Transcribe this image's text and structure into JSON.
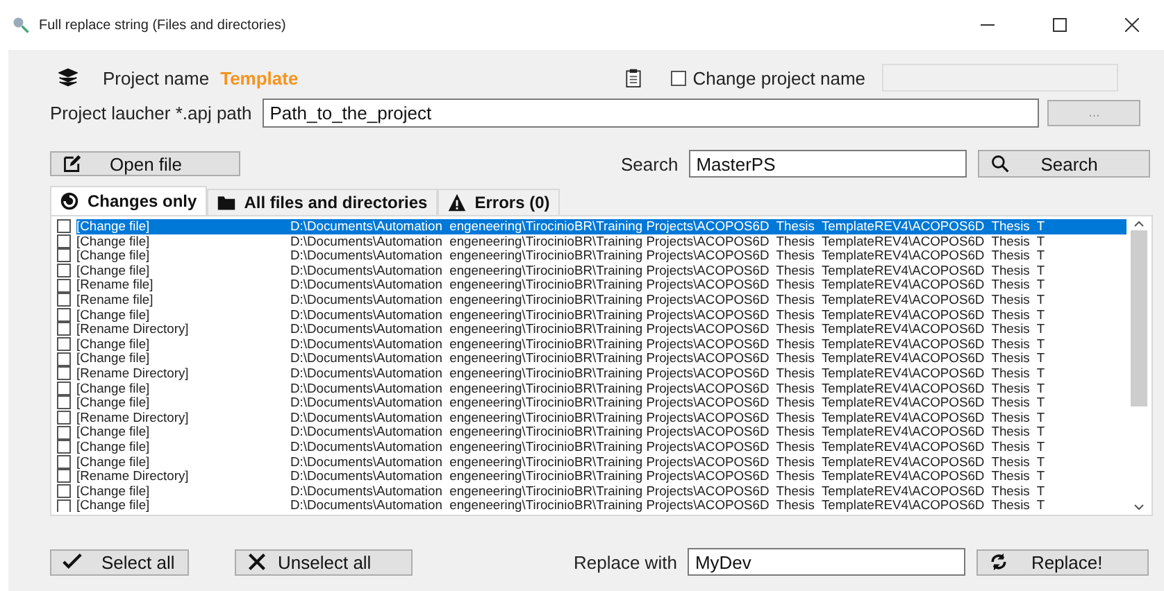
{
  "window": {
    "title": "Full replace string (Files and directories)"
  },
  "project": {
    "label": "Project name",
    "name": "Template"
  },
  "change_name": {
    "label": "Change project name",
    "checked": false,
    "value_disabled": true
  },
  "path": {
    "label": "Project laucher *.apj path",
    "value": "Path_to_the_project",
    "browse": "..."
  },
  "open_button": "Open file",
  "search": {
    "label": "Search",
    "value": "MasterPS",
    "button": "Search"
  },
  "tabs": [
    {
      "label": "Changes only",
      "kind": "changes",
      "selected": true
    },
    {
      "label": "All files and directories",
      "kind": "folder",
      "selected": false
    },
    {
      "label": "Errors (0)",
      "kind": "warning",
      "selected": false
    }
  ],
  "rows": [
    {
      "action": "[Change file]",
      "path": "D:\\Documents\\Automation  engeneering\\TirocinioBR\\Training Projects\\ACOPOS6D  Thesis  TemplateREV4\\ACOPOS6D  Thesis  T",
      "checked": false,
      "selected": true
    },
    {
      "action": "[Change file]",
      "path": "D:\\Documents\\Automation  engeneering\\TirocinioBR\\Training Projects\\ACOPOS6D  Thesis  TemplateREV4\\ACOPOS6D  Thesis  T",
      "checked": false,
      "selected": false
    },
    {
      "action": "[Change file]",
      "path": "D:\\Documents\\Automation  engeneering\\TirocinioBR\\Training Projects\\ACOPOS6D  Thesis  TemplateREV4\\ACOPOS6D  Thesis  T",
      "checked": false,
      "selected": false
    },
    {
      "action": "[Change file]",
      "path": "D:\\Documents\\Automation  engeneering\\TirocinioBR\\Training Projects\\ACOPOS6D  Thesis  TemplateREV4\\ACOPOS6D  Thesis  T",
      "checked": false,
      "selected": false
    },
    {
      "action": "[Rename file]",
      "path": "D:\\Documents\\Automation  engeneering\\TirocinioBR\\Training Projects\\ACOPOS6D  Thesis  TemplateREV4\\ACOPOS6D  Thesis  T",
      "checked": false,
      "selected": false
    },
    {
      "action": "[Rename file]",
      "path": "D:\\Documents\\Automation  engeneering\\TirocinioBR\\Training Projects\\ACOPOS6D  Thesis  TemplateREV4\\ACOPOS6D  Thesis  T",
      "checked": false,
      "selected": false
    },
    {
      "action": "[Change file]",
      "path": "D:\\Documents\\Automation  engeneering\\TirocinioBR\\Training Projects\\ACOPOS6D  Thesis  TemplateREV4\\ACOPOS6D  Thesis  T",
      "checked": false,
      "selected": false
    },
    {
      "action": "[Rename Directory]",
      "path": "D:\\Documents\\Automation  engeneering\\TirocinioBR\\Training Projects\\ACOPOS6D  Thesis  TemplateREV4\\ACOPOS6D  Thesis  T",
      "checked": false,
      "selected": false
    },
    {
      "action": "[Change file]",
      "path": "D:\\Documents\\Automation  engeneering\\TirocinioBR\\Training Projects\\ACOPOS6D  Thesis  TemplateREV4\\ACOPOS6D  Thesis  T",
      "checked": false,
      "selected": false
    },
    {
      "action": "[Change file]",
      "path": "D:\\Documents\\Automation  engeneering\\TirocinioBR\\Training Projects\\ACOPOS6D  Thesis  TemplateREV4\\ACOPOS6D  Thesis  T",
      "checked": false,
      "selected": false
    },
    {
      "action": "[Rename Directory]",
      "path": "D:\\Documents\\Automation  engeneering\\TirocinioBR\\Training Projects\\ACOPOS6D  Thesis  TemplateREV4\\ACOPOS6D  Thesis  T",
      "checked": false,
      "selected": false
    },
    {
      "action": "[Change file]",
      "path": "D:\\Documents\\Automation  engeneering\\TirocinioBR\\Training Projects\\ACOPOS6D  Thesis  TemplateREV4\\ACOPOS6D  Thesis  T",
      "checked": false,
      "selected": false
    },
    {
      "action": "[Change file]",
      "path": "D:\\Documents\\Automation  engeneering\\TirocinioBR\\Training Projects\\ACOPOS6D  Thesis  TemplateREV4\\ACOPOS6D  Thesis  T",
      "checked": false,
      "selected": false
    },
    {
      "action": "[Rename Directory]",
      "path": "D:\\Documents\\Automation  engeneering\\TirocinioBR\\Training Projects\\ACOPOS6D  Thesis  TemplateREV4\\ACOPOS6D  Thesis  T",
      "checked": false,
      "selected": false
    },
    {
      "action": "[Change file]",
      "path": "D:\\Documents\\Automation  engeneering\\TirocinioBR\\Training Projects\\ACOPOS6D  Thesis  TemplateREV4\\ACOPOS6D  Thesis  T",
      "checked": false,
      "selected": false
    },
    {
      "action": "[Change file]",
      "path": "D:\\Documents\\Automation  engeneering\\TirocinioBR\\Training Projects\\ACOPOS6D  Thesis  TemplateREV4\\ACOPOS6D  Thesis  T",
      "checked": false,
      "selected": false
    },
    {
      "action": "[Change file]",
      "path": "D:\\Documents\\Automation  engeneering\\TirocinioBR\\Training Projects\\ACOPOS6D  Thesis  TemplateREV4\\ACOPOS6D  Thesis  T",
      "checked": false,
      "selected": false
    },
    {
      "action": "[Rename Directory]",
      "path": "D:\\Documents\\Automation  engeneering\\TirocinioBR\\Training Projects\\ACOPOS6D  Thesis  TemplateREV4\\ACOPOS6D  Thesis  T",
      "checked": false,
      "selected": false
    },
    {
      "action": "[Change file]",
      "path": "D:\\Documents\\Automation  engeneering\\TirocinioBR\\Training Projects\\ACOPOS6D  Thesis  TemplateREV4\\ACOPOS6D  Thesis  T",
      "checked": false,
      "selected": false
    },
    {
      "action": "[Change file]",
      "path": "D:\\Documents\\Automation  engeneering\\TirocinioBR\\Training Projects\\ACOPOS6D  Thesis  TemplateREV4\\ACOPOS6D  Thesis  T",
      "checked": false,
      "selected": false
    }
  ],
  "footer": {
    "select_all": "Select all",
    "unselect_all": "Unselect all",
    "replace_label": "Replace with",
    "replace_value": "MyDev",
    "replace_button": "Replace!"
  }
}
